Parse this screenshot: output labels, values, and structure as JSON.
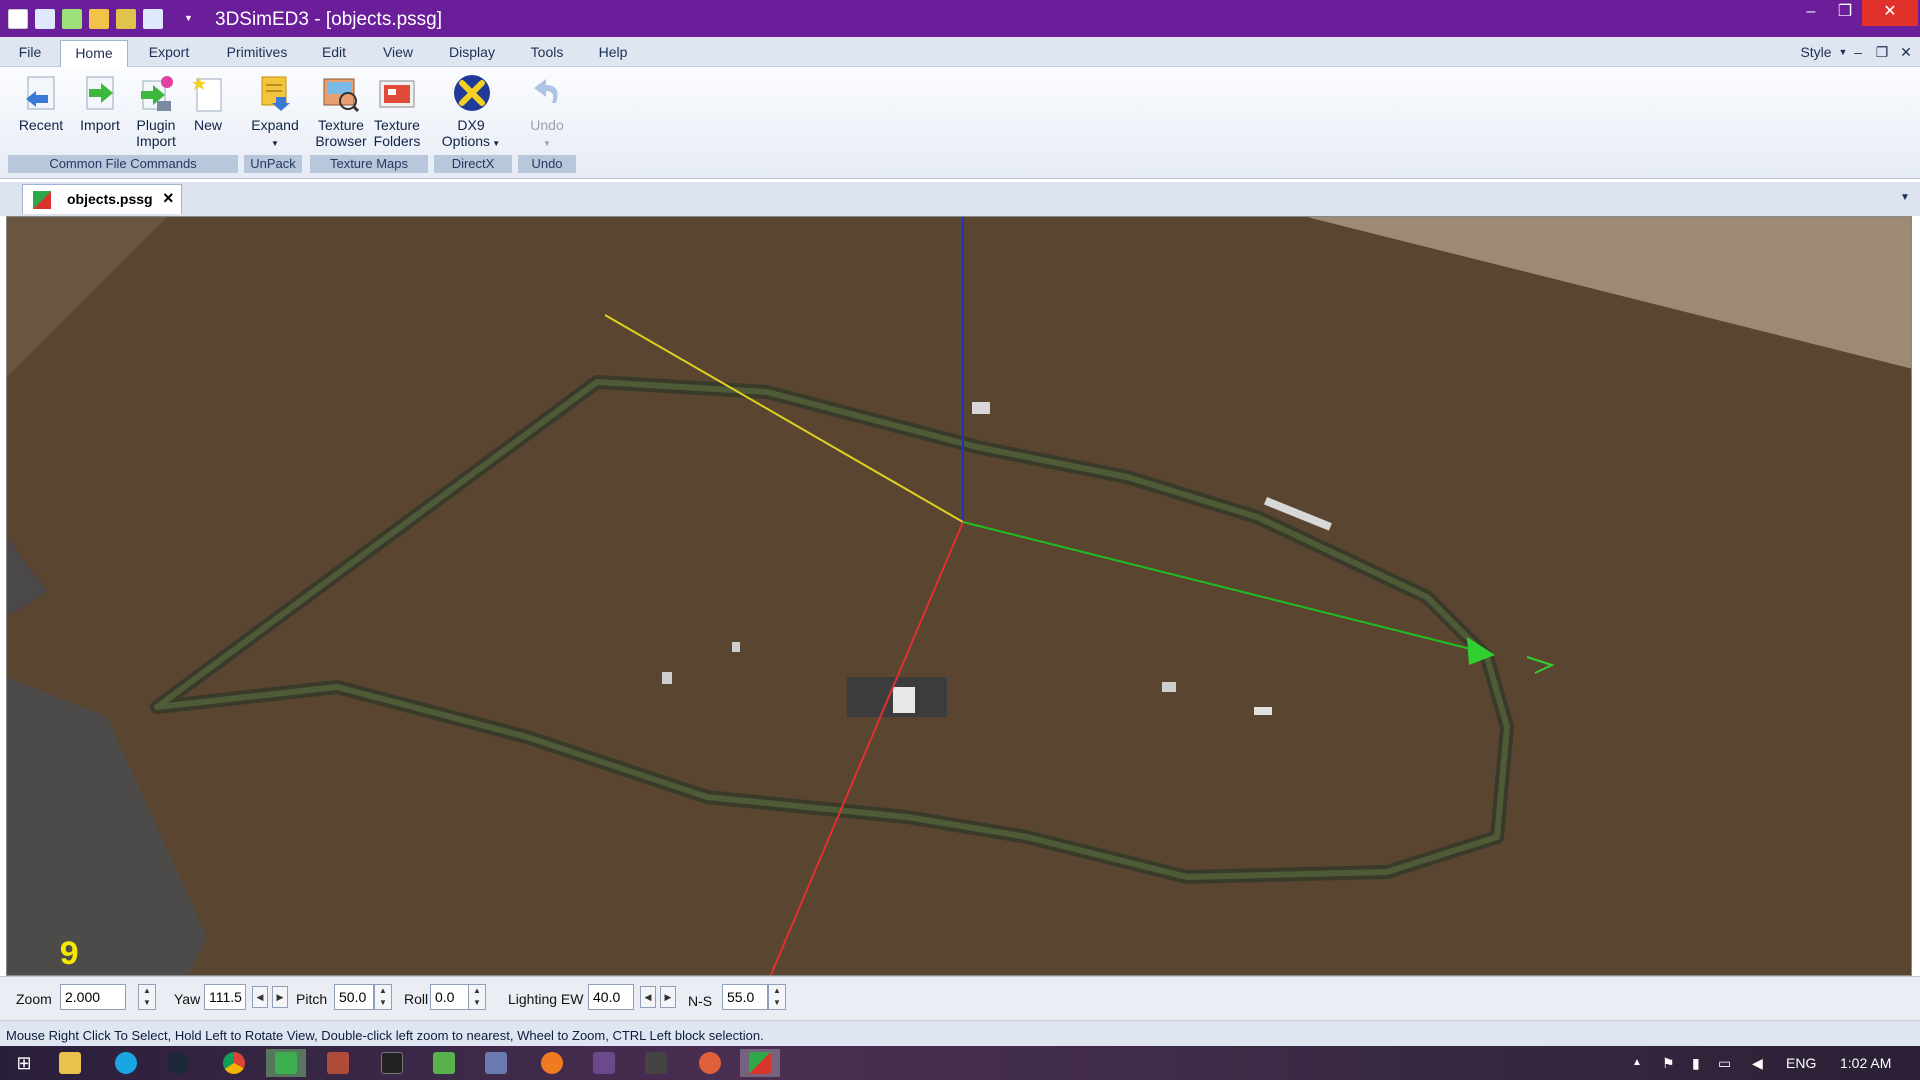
{
  "window": {
    "title": "3DSimED3 - [objects.pssg]",
    "min": "–",
    "restore": "❐",
    "close": "✕"
  },
  "menu": {
    "items": [
      "File",
      "Home",
      "Export",
      "Primitives",
      "Edit",
      "View",
      "Display",
      "Tools",
      "Help"
    ],
    "style_label": "Style"
  },
  "ribbon": {
    "buttons": {
      "recent": "Recent",
      "import": "Import",
      "plugin_line1": "Plugin",
      "plugin_line2": "Import",
      "new": "New",
      "expand": "Expand",
      "texbrowser_line1": "Texture",
      "texbrowser_line2": "Browser",
      "texfolders_line1": "Texture",
      "texfolders_line2": "Folders",
      "dx9_line1": "DX9",
      "dx9_line2": "Options",
      "undo": "Undo"
    },
    "groups": [
      "Common File Commands",
      "UnPack",
      "Texture Maps",
      "DirectX",
      "Undo"
    ]
  },
  "document_tab": {
    "label": "objects.pssg",
    "close": "×"
  },
  "viewport": {
    "overlay_number": "9"
  },
  "controls": {
    "zoom_label": "Zoom",
    "zoom_value": "2.000",
    "yaw_label": "Yaw",
    "yaw_value": "111.5",
    "pitch_label": "Pitch",
    "pitch_value": "50.0",
    "roll_label": "Roll",
    "roll_value": "0.0",
    "lighting_label": "Lighting EW",
    "lighting_value": "40.0",
    "ns_label": "N-S",
    "ns_value": "55.0"
  },
  "status": {
    "text": "Mouse Right Click To Select, Hold Left to Rotate View, Double-click left  zoom to nearest, Wheel to Zoom, CTRL Left block selection."
  },
  "taskbar": {
    "lang": "ENG",
    "time": "1:02 AM"
  },
  "colors": {
    "titlebar": "#6b1e9a",
    "viewport_ground": "#5a4530",
    "axis_x": "#e03030",
    "axis_y": "#20c020",
    "axis_z": "#2030c0",
    "axis_light": "#e0d020"
  }
}
